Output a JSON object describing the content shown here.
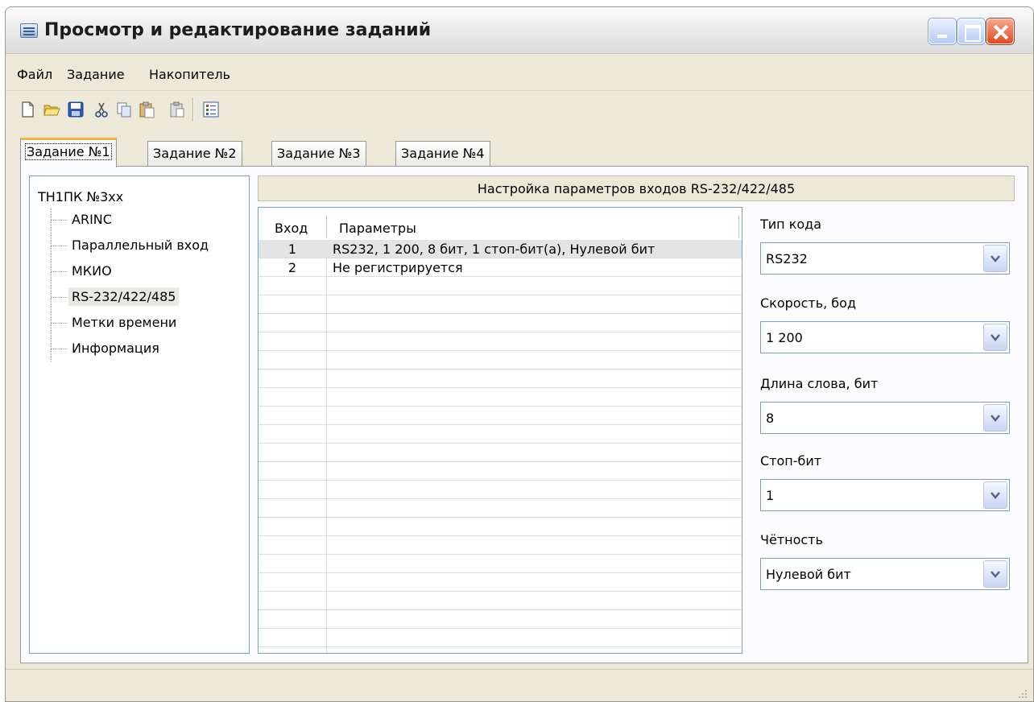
{
  "window": {
    "title": "Просмотр и редактирование заданий"
  },
  "menu": {
    "items": [
      "Файл",
      "Задание",
      "Накопитель"
    ]
  },
  "toolbar": {
    "buttons": [
      "new-icon",
      "open-icon",
      "save-icon",
      "cut-icon",
      "copy-icon",
      "paste-icon",
      "paste-special-icon",
      "list-icon"
    ]
  },
  "tabs": [
    "Задание №1",
    "Задание №2",
    "Задание №3",
    "Задание №4"
  ],
  "tree": {
    "root": "ТН1ПК №3хх",
    "items": [
      "ARINC",
      "Параллельный вход",
      "МКИО",
      "RS-232/422/485",
      "Метки времени",
      "Информация"
    ],
    "selected": "RS-232/422/485"
  },
  "panel": {
    "title": "Настройка параметров входов RS-232/422/485"
  },
  "grid": {
    "columns": [
      "Вход",
      "Параметры"
    ],
    "rows": [
      {
        "num": "1",
        "params": "RS232, 1 200, 8 бит, 1 стоп-бит(а), Нулевой бит"
      },
      {
        "num": "2",
        "params": "Не регистрируется"
      }
    ]
  },
  "settings": {
    "code_type": {
      "label": "Тип кода",
      "value": "RS232"
    },
    "speed": {
      "label": "Скорость, бод",
      "value": "1 200"
    },
    "word_length": {
      "label": "Длина слова, бит",
      "value": "8"
    },
    "stop_bits": {
      "label": "Стоп-бит",
      "value": "1"
    },
    "parity": {
      "label": "Чётность",
      "value": "Нулевой бит"
    }
  },
  "colors": {
    "window_bg": "#ece9d8",
    "active_tab_accent": "#f3b43a",
    "control_border": "#7f9db9",
    "close_button": "#e04b22"
  }
}
